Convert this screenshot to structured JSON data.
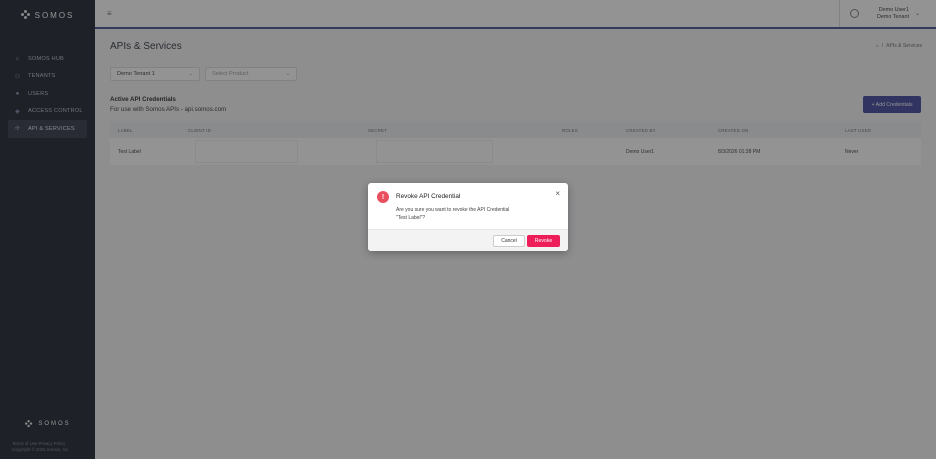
{
  "brand": {
    "name": "SOMOS"
  },
  "sidebar": {
    "items": [
      {
        "label": "SOMOS HUB",
        "icon": "home-icon"
      },
      {
        "label": "TENANTS",
        "icon": "tenants-icon"
      },
      {
        "label": "USERS",
        "icon": "user-icon"
      },
      {
        "label": "ACCESS CONTROL",
        "icon": "shield-icon"
      },
      {
        "label": "API & SERVICES",
        "icon": "api-icon",
        "active": true
      }
    ],
    "footer_links": "Terms of Use   Privacy Policy",
    "copyright": "Copyright © 2026 Somos, Inc."
  },
  "header": {
    "user_name": "Demo User1",
    "tenant_name": "Demo Tenant"
  },
  "page": {
    "title": "APIs & Services",
    "breadcrumb": "APIs & Services",
    "tenant_select": "Demo Tenant 1",
    "product_select": "Select Product",
    "section_title": "Active API Credentials",
    "section_sub": "For use with Somos APIs - api.somos.com",
    "add_button": "+ Add Credentials"
  },
  "table": {
    "columns": [
      "LABEL",
      "CLIENT ID",
      "SECRET",
      "ROLES",
      "CREATED BY",
      "CREATED ON",
      "LAST USED"
    ],
    "rows": [
      {
        "label": "Test Label",
        "client_id": "",
        "secret": "",
        "roles": "",
        "created_by": "Demo User1",
        "created_on": "8/3/2026 01:38 PM",
        "last_used": "Never"
      }
    ]
  },
  "modal": {
    "title": "Revoke API Credential",
    "body_line1": "Are you sure you want to revoke the API Credential",
    "body_line2": "\"Test Label\"?",
    "cancel": "Cancel",
    "confirm": "Revoke",
    "accent": "#ed1e5a"
  }
}
